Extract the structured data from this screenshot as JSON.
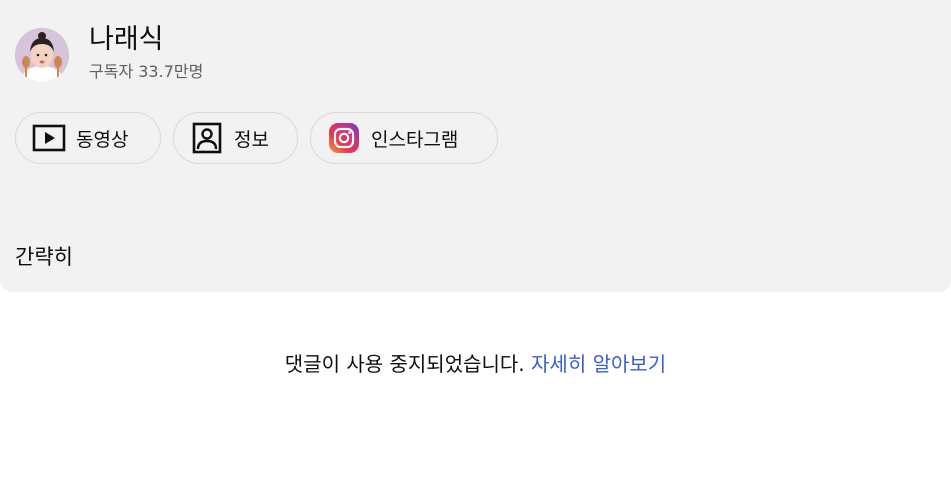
{
  "channel": {
    "name": "나래식",
    "subscribers": "구독자 33.7만명"
  },
  "chips": [
    {
      "label": "동영상",
      "icon": "play-box-icon"
    },
    {
      "label": "정보",
      "icon": "portrait-icon"
    },
    {
      "label": "인스타그램",
      "icon": "instagram-icon"
    }
  ],
  "description": {
    "collapse_label": "간략히"
  },
  "comments": {
    "disabled_text": "댓글이 사용 중지되었습니다.",
    "learn_more": "자세히 알아보기"
  },
  "colors": {
    "panel_bg": "#f2f2f2",
    "link": "#3b5fcb",
    "text": "#0f0f0f",
    "secondary_text": "#606060"
  }
}
